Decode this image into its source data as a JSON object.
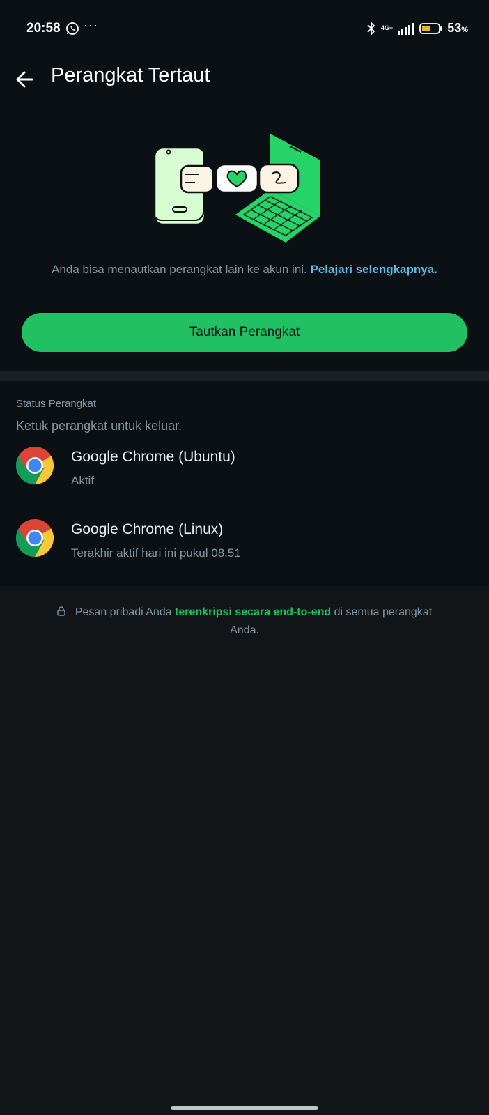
{
  "status_bar": {
    "time": "20:58",
    "network": "4G+",
    "battery_percent": "53",
    "battery_unit": "%",
    "battery_level": 0.53,
    "icons": [
      "whatsapp-icon",
      "more-dots-icon",
      "bluetooth-icon",
      "signal-icon",
      "battery-icon"
    ]
  },
  "app_bar": {
    "title": "Perangkat Tertaut",
    "back_icon": "arrow-left-icon"
  },
  "hero": {
    "description": "Anda bisa menautkan perangkat lain ke akun ini. ",
    "learn_more": "Pelajari selengkapnya",
    "period": ".",
    "link_device_button": "Tautkan Perangkat"
  },
  "devices": {
    "section_title": "Status Perangkat",
    "hint": "Ketuk perangkat untuk keluar.",
    "items": [
      {
        "name": "Google Chrome (Ubuntu)",
        "status": "Aktif",
        "icon": "chrome-icon"
      },
      {
        "name": "Google Chrome (Linux)",
        "status": "Terakhir aktif hari ini pukul 08.51",
        "icon": "chrome-icon"
      }
    ]
  },
  "footer": {
    "text_before": "Pesan pribadi Anda ",
    "highlight": "terenkripsi secara end-to-end",
    "text_after": " di semua perangkat Anda."
  },
  "colors": {
    "background": "#121619",
    "surface": "#0b1014",
    "accent_green": "#21c063",
    "link_blue": "#53bdeb",
    "secondary_text": "#8696a0"
  }
}
